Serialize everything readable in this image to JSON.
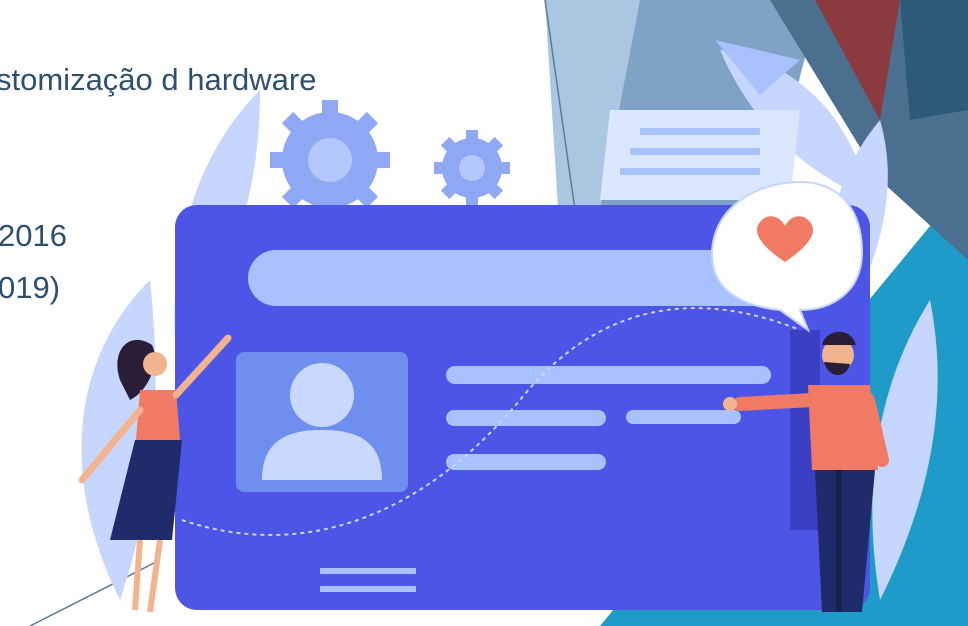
{
  "slide": {
    "text_lines": [
      "stomização d  hardware",
      "2016",
      "019)"
    ]
  },
  "illustration": {
    "name": "profile-card-illustration",
    "colors": {
      "card": "#4c55e6",
      "card_dark": "#3a3fc4",
      "avatar_frame": "#6f8ff0",
      "avatar": "#c9d8ff",
      "bar_light": "#a8c1ff",
      "leaf": "#c6d6ff",
      "gear": "#8ea8f4",
      "heart": "#f07a63",
      "shirt": "#f07a63",
      "pants": "#1f2b6b",
      "skin": "#f2b38f",
      "hair": "#2a1d38"
    }
  },
  "background_shapes": {
    "colors": {
      "teal": "#1e9bc8",
      "blue_grey": "#7fa3c5",
      "light_blue": "#a9c7e0",
      "steel": "#4a6f8f",
      "maroon": "#8b3b3f",
      "navy": "#2e5a7a"
    }
  }
}
